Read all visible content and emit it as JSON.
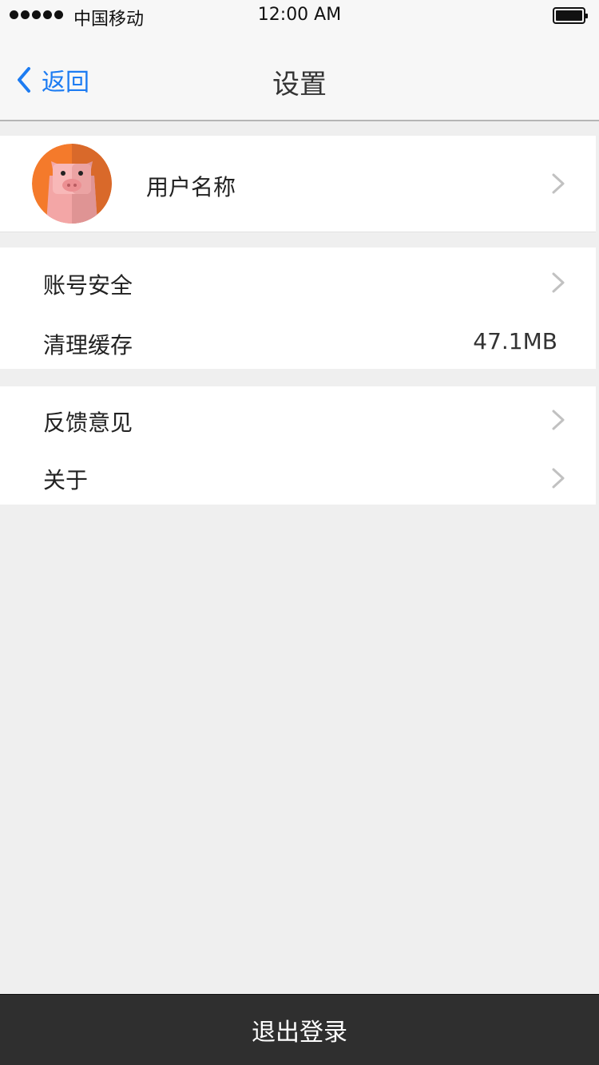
{
  "status_bar": {
    "carrier": "中国移动",
    "time": "12:00 AM",
    "signal_bars": 5
  },
  "nav": {
    "back_label": "返回",
    "title": "设置",
    "back_icon": "chevron-left-icon"
  },
  "profile": {
    "name": "用户名称",
    "avatar_icon": "pig-avatar-icon"
  },
  "settings_group_1": [
    {
      "label": "账号安全",
      "value": "",
      "icon": "chevron-right-icon"
    },
    {
      "label": "清理缓存",
      "value": "47.1MB",
      "icon": ""
    }
  ],
  "settings_group_2": [
    {
      "label": "反馈意见",
      "value": "",
      "icon": "chevron-right-icon"
    },
    {
      "label": "关于",
      "value": "",
      "icon": "chevron-right-icon"
    }
  ],
  "logout": {
    "label": "退出登录"
  },
  "colors": {
    "accent": "#1d7cf2",
    "background": "#efefef",
    "logout_bar": "#2f2f2f",
    "avatar_orange": "#f47a2b",
    "pig_pink": "#f3a6a6"
  }
}
